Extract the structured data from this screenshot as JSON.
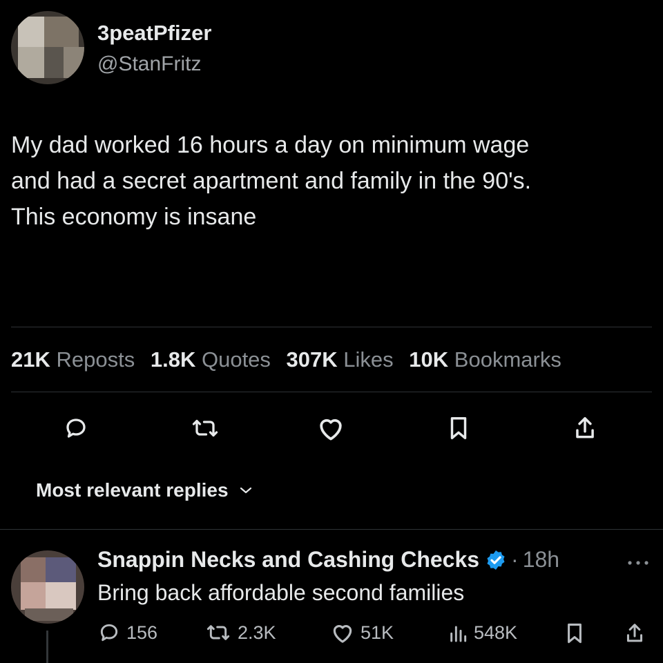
{
  "tweet": {
    "display_name": "3peatPfizer",
    "handle": "@StanFritz",
    "text_lines": [
      "My dad worked 16 hours a day on minimum wage",
      "and had a secret apartment and family in the 90's.",
      "This economy is insane"
    ],
    "stats": [
      {
        "num": "21K",
        "label": "Reposts"
      },
      {
        "num": "1.8K",
        "label": "Quotes"
      },
      {
        "num": "307K",
        "label": "Likes"
      },
      {
        "num": "10K",
        "label": "Bookmarks"
      }
    ]
  },
  "replies_sort": {
    "label": "Most relevant replies"
  },
  "reply": {
    "display_name": "Snappin Necks and Cashing Checks",
    "time": "18h",
    "separator": "·",
    "text": "Bring back affordable second families",
    "counts": {
      "replies": "156",
      "reposts": "2.3K",
      "likes": "51K",
      "views": "548K"
    }
  },
  "colors": {
    "background": "#000000",
    "text": "#e7e9ea",
    "muted": "#8b9095",
    "verified": "#1d9bf0",
    "divider": "#2f3336"
  },
  "icons": [
    "reply-icon",
    "repost-icon",
    "like-icon",
    "bookmark-icon",
    "share-icon",
    "chevron-down-icon",
    "verified-badge-icon",
    "more-icon",
    "views-icon"
  ]
}
